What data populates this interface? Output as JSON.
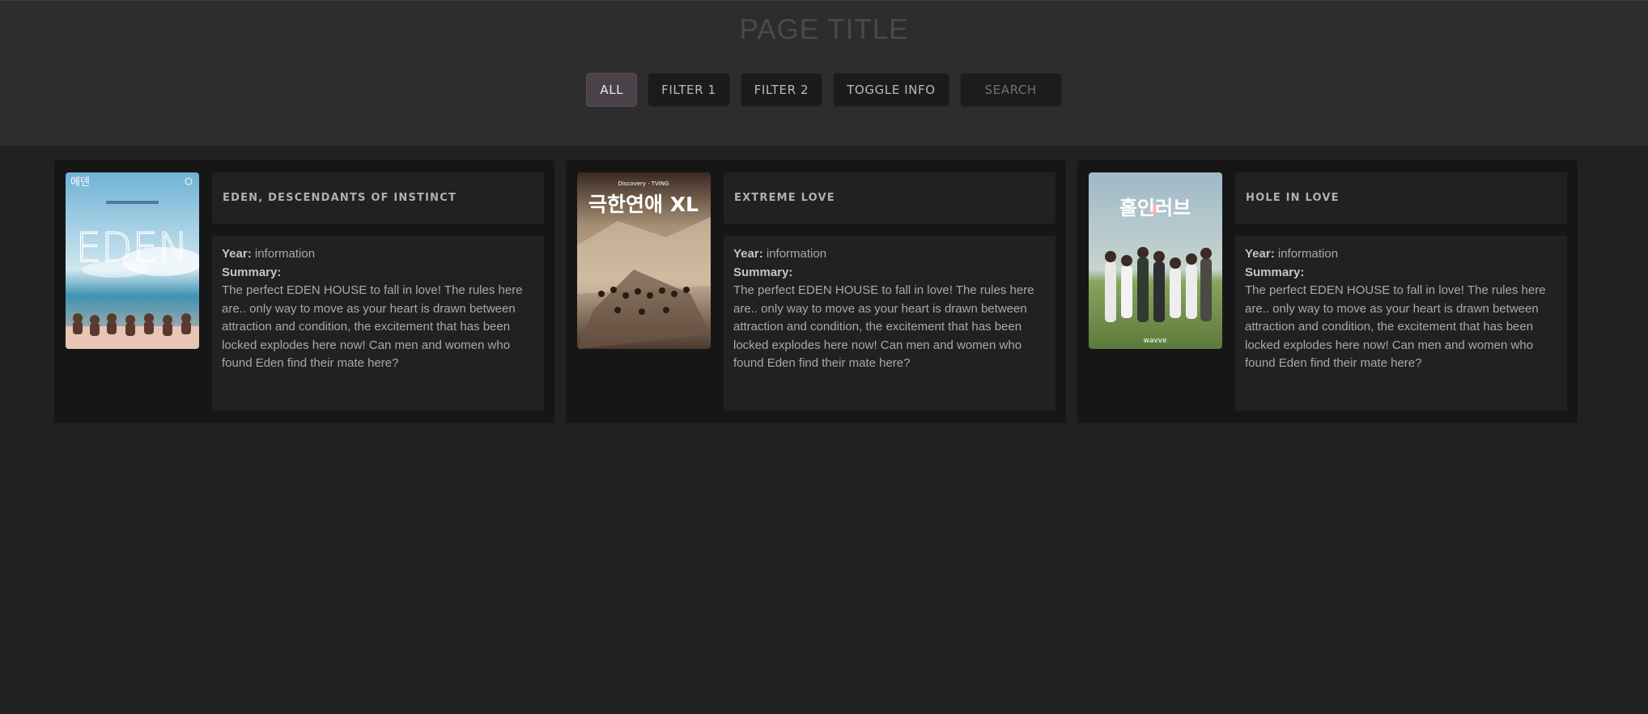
{
  "header": {
    "title": "PAGE TITLE",
    "filters": [
      {
        "label": "ALL",
        "active": true
      },
      {
        "label": "FILTER 1",
        "active": false
      },
      {
        "label": "FILTER 2",
        "active": false
      },
      {
        "label": "TOGGLE INFO",
        "active": false
      }
    ],
    "search_placeholder": "SEARCH"
  },
  "cards": [
    {
      "title": "EDEN, DESCENDANTS OF INSTINCT",
      "year_label": "Year:",
      "year_value": " information",
      "summary_label": "Summary:",
      "summary": "The perfect EDEN HOUSE to fall in love! The rules here are.. only way to move as your heart is drawn between attraction and condition, the excitement that has been locked explodes here now! Can men and women who found Eden find their mate here?",
      "poster_text": "EDEN"
    },
    {
      "title": "EXTREME LOVE",
      "year_label": "Year:",
      "year_value": " information",
      "summary_label": "Summary:",
      "summary": "The perfect EDEN HOUSE to fall in love! The rules here are.. only way to move as your heart is drawn between attraction and condition, the excitement that has been locked explodes here now! Can men and women who found Eden find their mate here?",
      "poster_text": "극한연애 XL"
    },
    {
      "title": "HOLE IN LOVE",
      "year_label": "Year:",
      "year_value": " information",
      "summary_label": "Summary:",
      "summary": "The perfect EDEN HOUSE to fall in love! The rules here are.. only way to move as your heart is drawn between attraction and condition, the excitement that has been locked explodes here now! Can men and women who found Eden find their mate here?",
      "poster_text": "홀인러브"
    }
  ]
}
